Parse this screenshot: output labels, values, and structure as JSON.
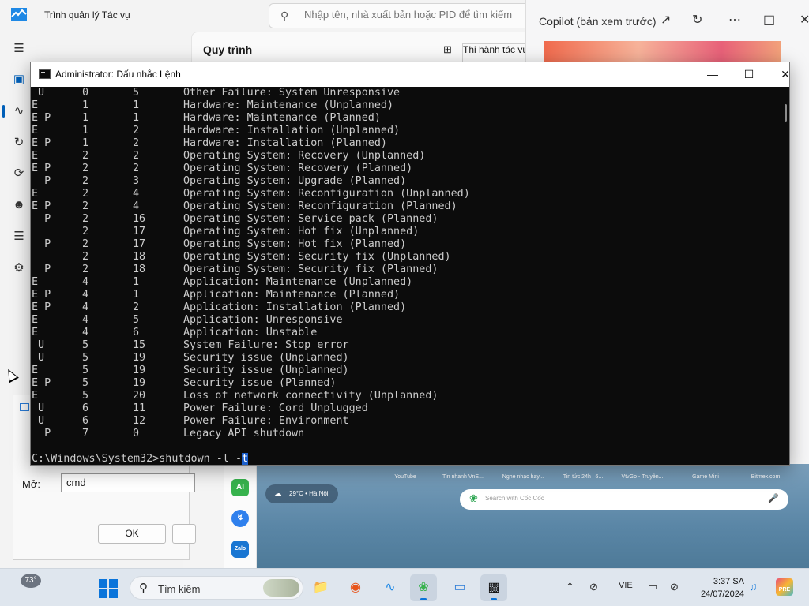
{
  "task_manager": {
    "title": "Trình quản lý Tác vụ",
    "search_placeholder": "Nhập tên, nhà xuất bản hoặc PID để tìm kiếm",
    "section_title": "Quy trình",
    "run_task_label": "Thi hành tác vụ"
  },
  "copilot": {
    "title": "Copilot (bản xem trước)"
  },
  "run_dialog": {
    "open_label": "Mở:",
    "input_value": "cmd",
    "ok_label": "OK"
  },
  "cmd": {
    "title": "Administrator: Dấu nhắc Lệnh",
    "rows": [
      {
        "flags": " U",
        "major": "0",
        "minor": "5",
        "reason": "Other Failure: System Unresponsive"
      },
      {
        "flags": "E",
        "major": "1",
        "minor": "1",
        "reason": "Hardware: Maintenance (Unplanned)"
      },
      {
        "flags": "E P",
        "major": "1",
        "minor": "1",
        "reason": "Hardware: Maintenance (Planned)"
      },
      {
        "flags": "E",
        "major": "1",
        "minor": "2",
        "reason": "Hardware: Installation (Unplanned)"
      },
      {
        "flags": "E P",
        "major": "1",
        "minor": "2",
        "reason": "Hardware: Installation (Planned)"
      },
      {
        "flags": "E",
        "major": "2",
        "minor": "2",
        "reason": "Operating System: Recovery (Unplanned)"
      },
      {
        "flags": "E P",
        "major": "2",
        "minor": "2",
        "reason": "Operating System: Recovery (Planned)"
      },
      {
        "flags": "  P",
        "major": "2",
        "minor": "3",
        "reason": "Operating System: Upgrade (Planned)"
      },
      {
        "flags": "E",
        "major": "2",
        "minor": "4",
        "reason": "Operating System: Reconfiguration (Unplanned)"
      },
      {
        "flags": "E P",
        "major": "2",
        "minor": "4",
        "reason": "Operating System: Reconfiguration (Planned)"
      },
      {
        "flags": "  P",
        "major": "2",
        "minor": "16",
        "reason": "Operating System: Service pack (Planned)"
      },
      {
        "flags": "",
        "major": "2",
        "minor": "17",
        "reason": "Operating System: Hot fix (Unplanned)"
      },
      {
        "flags": "  P",
        "major": "2",
        "minor": "17",
        "reason": "Operating System: Hot fix (Planned)"
      },
      {
        "flags": "",
        "major": "2",
        "minor": "18",
        "reason": "Operating System: Security fix (Unplanned)"
      },
      {
        "flags": "  P",
        "major": "2",
        "minor": "18",
        "reason": "Operating System: Security fix (Planned)"
      },
      {
        "flags": "E",
        "major": "4",
        "minor": "1",
        "reason": "Application: Maintenance (Unplanned)"
      },
      {
        "flags": "E P",
        "major": "4",
        "minor": "1",
        "reason": "Application: Maintenance (Planned)"
      },
      {
        "flags": "E P",
        "major": "4",
        "minor": "2",
        "reason": "Application: Installation (Planned)"
      },
      {
        "flags": "E",
        "major": "4",
        "minor": "5",
        "reason": "Application: Unresponsive"
      },
      {
        "flags": "E",
        "major": "4",
        "minor": "6",
        "reason": "Application: Unstable"
      },
      {
        "flags": " U",
        "major": "5",
        "minor": "15",
        "reason": "System Failure: Stop error"
      },
      {
        "flags": " U",
        "major": "5",
        "minor": "19",
        "reason": "Security issue (Unplanned)"
      },
      {
        "flags": "E",
        "major": "5",
        "minor": "19",
        "reason": "Security issue (Unplanned)"
      },
      {
        "flags": "E P",
        "major": "5",
        "minor": "19",
        "reason": "Security issue (Planned)"
      },
      {
        "flags": "E",
        "major": "5",
        "minor": "20",
        "reason": "Loss of network connectivity (Unplanned)"
      },
      {
        "flags": " U",
        "major": "6",
        "minor": "11",
        "reason": "Power Failure: Cord Unplugged"
      },
      {
        "flags": " U",
        "major": "6",
        "minor": "12",
        "reason": "Power Failure: Environment"
      },
      {
        "flags": "  P",
        "major": "7",
        "minor": "0",
        "reason": "Legacy API shutdown"
      }
    ],
    "prompt": "C:\\Windows\\System32>shutdown -l -",
    "prompt_selected": "t"
  },
  "browser": {
    "shortcuts": [
      "YouTube",
      "Tin nhanh VnE...",
      "Nghe nhạc hay...",
      "Tin tức 24h | 6...",
      "VtvGo - Truyền...",
      "Game Mini",
      "Bitmex.com"
    ],
    "weather": "29°C • Hà Nội",
    "search_placeholder": "Search with Cốc Cốc",
    "sidebar_apps": [
      "AI",
      "Messenger",
      "Zalo"
    ]
  },
  "taskbar": {
    "weather_temp": "73°",
    "search_label": "Tìm kiếm",
    "language": "VIE",
    "time": "3:37 SA",
    "date": "24/07/2024",
    "pre_badge": "PRE"
  },
  "colors": {
    "console_bg": "#0c0c0c",
    "console_text": "#cccccc",
    "selection": "#1b5fcc",
    "accent": "#0a74da"
  },
  "icons": {
    "tm_nav": [
      "hamburger-icon",
      "processes-icon",
      "performance-icon",
      "app-history-icon",
      "startup-icon",
      "users-icon",
      "details-icon",
      "services-icon"
    ]
  }
}
